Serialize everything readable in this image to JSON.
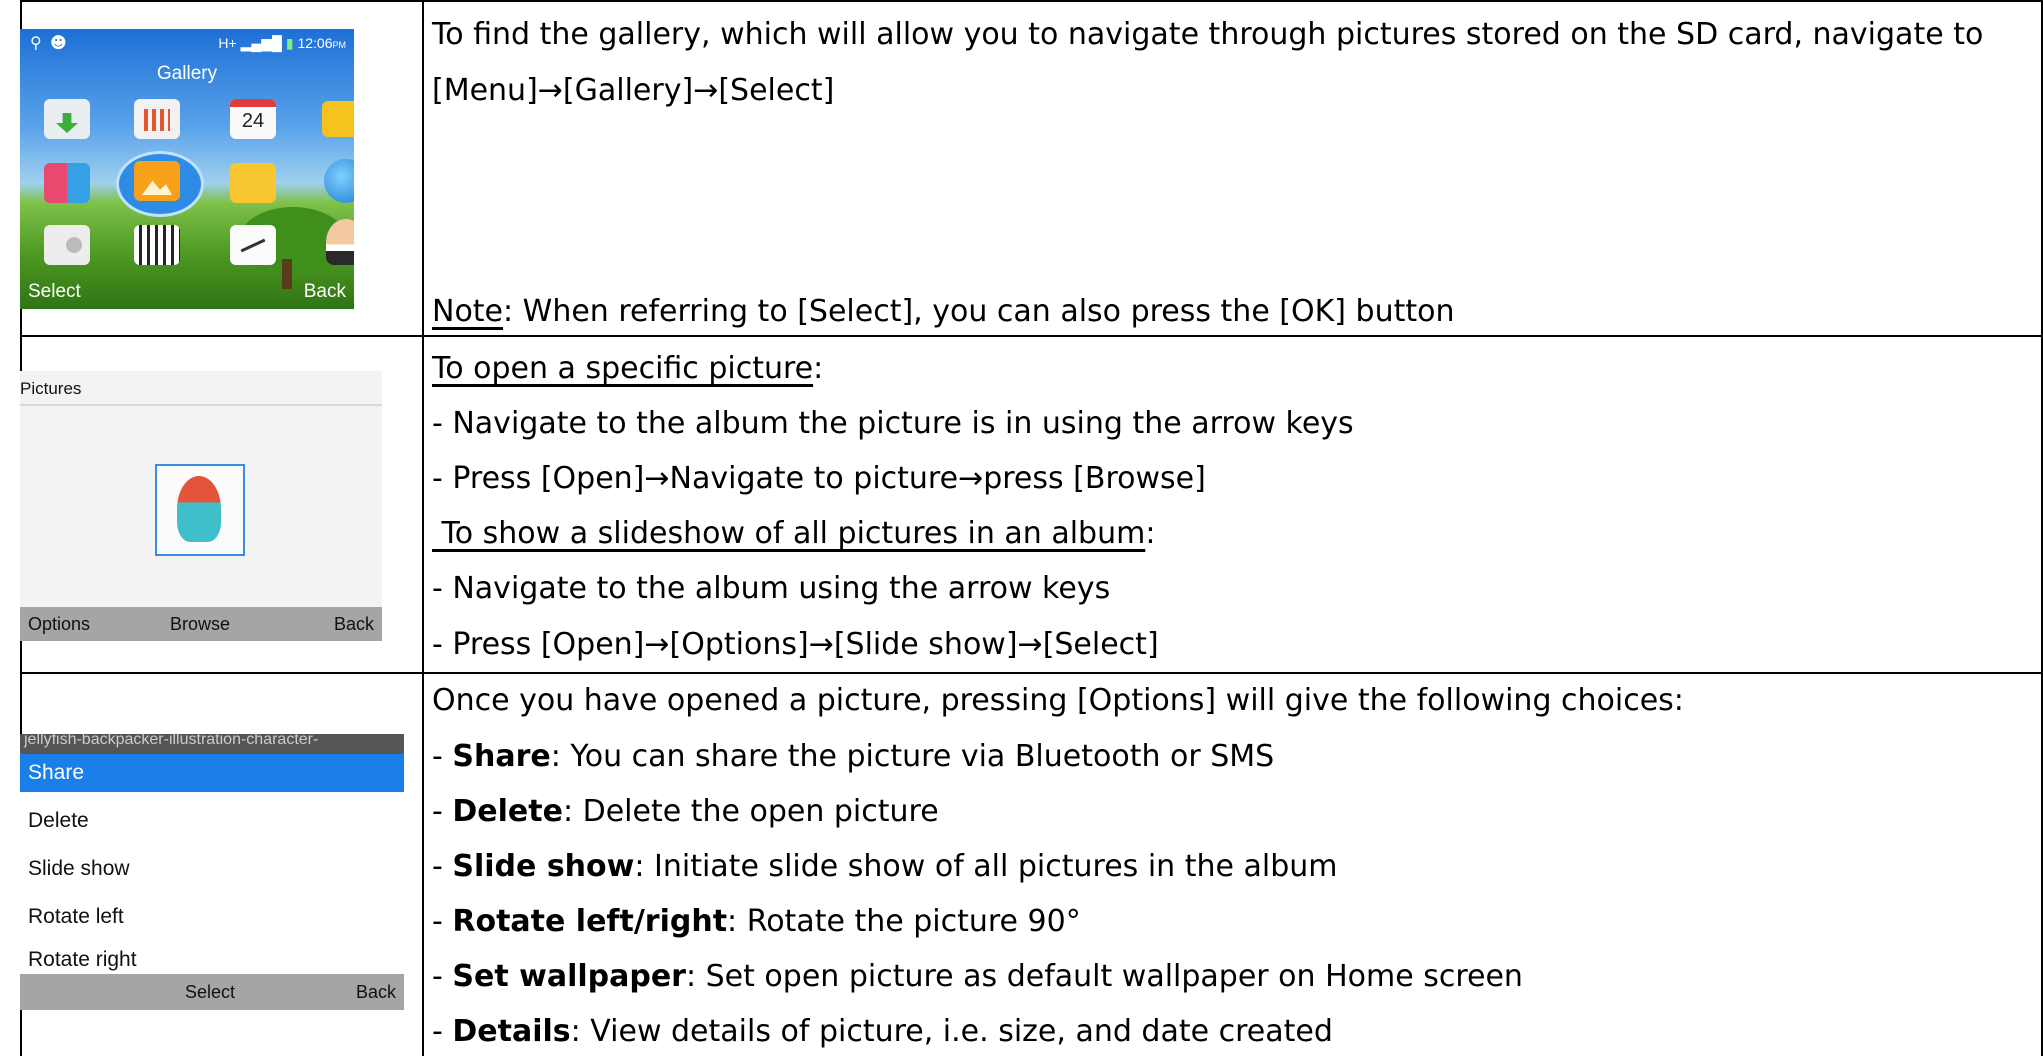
{
  "row1": {
    "phone": {
      "status_time": "12:06",
      "status_ampm": "PM",
      "network": "H+",
      "title": "Gallery",
      "calendar_day": "24",
      "soft_left": "Select",
      "soft_right": "Back",
      "icons": [
        "download-icon",
        "equalizer-icon",
        "calendar-icon",
        "mail-icon",
        "apps-icon",
        "gallery-icon",
        "folder-icon",
        "globe-icon",
        "radio-icon",
        "piano-icon",
        "clock-icon",
        "contacts-icon"
      ]
    },
    "line1": "To find the gallery, which will allow you to navigate through pictures stored on the SD card, navigate to",
    "line2_a": "[Menu]",
    "line2_b": "[Gallery]",
    "line2_c": "[Select]",
    "note_label": "Note",
    "note_text": ": When referring to [Select], you can also press the [OK] button"
  },
  "row2": {
    "phone": {
      "title": "Pictures",
      "soft_left": "Options",
      "soft_mid": "Browse",
      "soft_right": "Back"
    },
    "h1": "To open a specific picture",
    "h1_colon": ":",
    "l1": "- Navigate to the album the picture is in using the arrow keys",
    "l2_a": "- Press [Open]",
    "l2_b": "Navigate to picture",
    "l2_c": "press [Browse]",
    "h2": " To show a slideshow of all pictures in an album",
    "h2_colon": ":",
    "l3": "- Navigate to the album using the arrow keys",
    "l4_a": "- Press [Open]",
    "l4_b": "[Options]",
    "l4_c": "[Slide show]",
    "l4_d": "[Select]"
  },
  "row3": {
    "phone": {
      "filename": "jellyfish-backpacker-illustration-character-",
      "items": [
        "Share",
        "Delete",
        "Slide show",
        "Rotate left",
        "Rotate right"
      ],
      "soft_mid": "Select",
      "soft_right": "Back"
    },
    "intro": "Once you have opened a picture, pressing [Options] will give the following choices:",
    "options": [
      {
        "name": "Share",
        "desc": ": You can share the picture via Bluetooth or SMS"
      },
      {
        "name": "Delete",
        "desc": ": Delete the open picture"
      },
      {
        "name": "Slide show",
        "desc": ": Initiate slide show of all pictures in the album"
      },
      {
        "name": "Rotate left/right",
        "desc": ": Rotate the picture 90°"
      },
      {
        "name": "Set wallpaper",
        "desc": ": Set open picture as default wallpaper on Home screen"
      },
      {
        "name": "Details",
        "desc": ": View details of picture, i.e. size, and date created"
      }
    ]
  },
  "arrow": "→"
}
